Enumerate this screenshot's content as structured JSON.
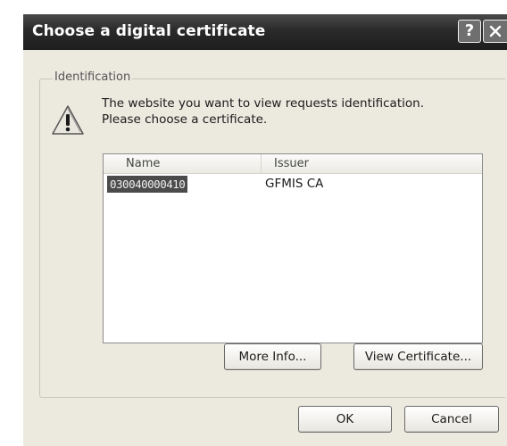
{
  "window": {
    "title": "Choose a digital certificate",
    "help_label": "?",
    "close_icon": "close-icon"
  },
  "identification": {
    "group_label": "Identification",
    "icon": "warning-icon",
    "message_line1": "The website you want to view requests identification.",
    "message_line2": "Please choose a certificate."
  },
  "certificate_list": {
    "columns": [
      "Name",
      "Issuer"
    ],
    "rows": [
      {
        "name": "030040000410",
        "issuer": "GFMIS CA",
        "selected": true
      }
    ]
  },
  "buttons": {
    "more_info": "More Info...",
    "view_certificate": "View Certificate...",
    "ok": "OK",
    "cancel": "Cancel"
  },
  "colors": {
    "titlebar": "#2a2a2a",
    "dialog_background": "#ece9df",
    "selection": "#4b4b4b"
  }
}
